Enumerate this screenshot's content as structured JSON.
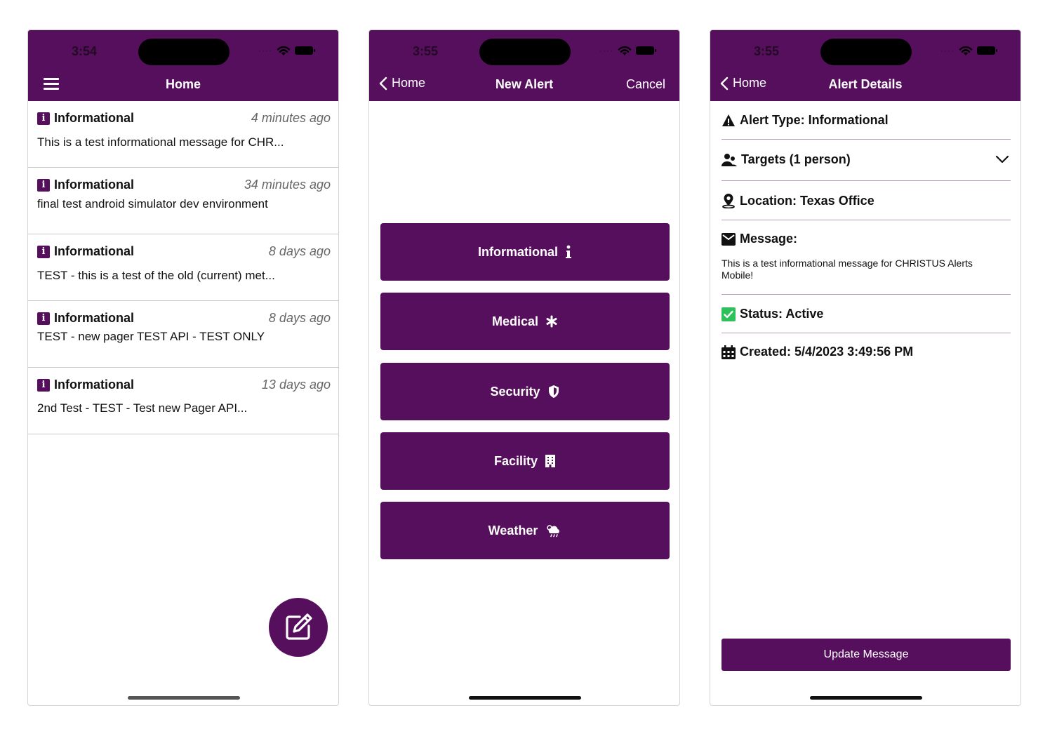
{
  "screens": {
    "home": {
      "status_time": "3:54",
      "nav_title": "Home",
      "alerts": [
        {
          "type": "Informational",
          "time": "4 minutes ago",
          "message": "This is a test informational message for CHR..."
        },
        {
          "type": "Informational",
          "time": "34 minutes ago",
          "message": "final test android simulator dev environment"
        },
        {
          "type": "Informational",
          "time": "8 days ago",
          "message": "TEST - this is a test of the old (current) met..."
        },
        {
          "type": "Informational",
          "time": "8 days ago",
          "message": "TEST - new pager TEST API - TEST ONLY"
        },
        {
          "type": "Informational",
          "time": "13 days ago",
          "message": "2nd Test - TEST - Test new Pager API..."
        }
      ]
    },
    "new_alert": {
      "status_time": "3:55",
      "back_label": "Home",
      "nav_title": "New Alert",
      "cancel_label": "Cancel",
      "types": [
        {
          "label": "Informational",
          "icon": "info-icon"
        },
        {
          "label": "Medical",
          "icon": "asterisk-icon"
        },
        {
          "label": "Security",
          "icon": "shield-icon"
        },
        {
          "label": "Facility",
          "icon": "building-icon"
        },
        {
          "label": "Weather",
          "icon": "cloud-rain-icon"
        }
      ]
    },
    "details": {
      "status_time": "3:55",
      "back_label": "Home",
      "nav_title": "Alert Details",
      "alert_type": "Alert Type: Informational",
      "targets": "Targets (1 person)",
      "location": "Location: Texas Office",
      "message_label": "Message:",
      "message_text": "This is a test informational message for CHRISTUS Alerts Mobile!",
      "status": "Status: Active",
      "created": "Created: 5/4/2023 3:49:56 PM",
      "update_button": "Update Message"
    }
  },
  "colors": {
    "brand": "#560f5c",
    "status_active": "#2ec05a"
  }
}
